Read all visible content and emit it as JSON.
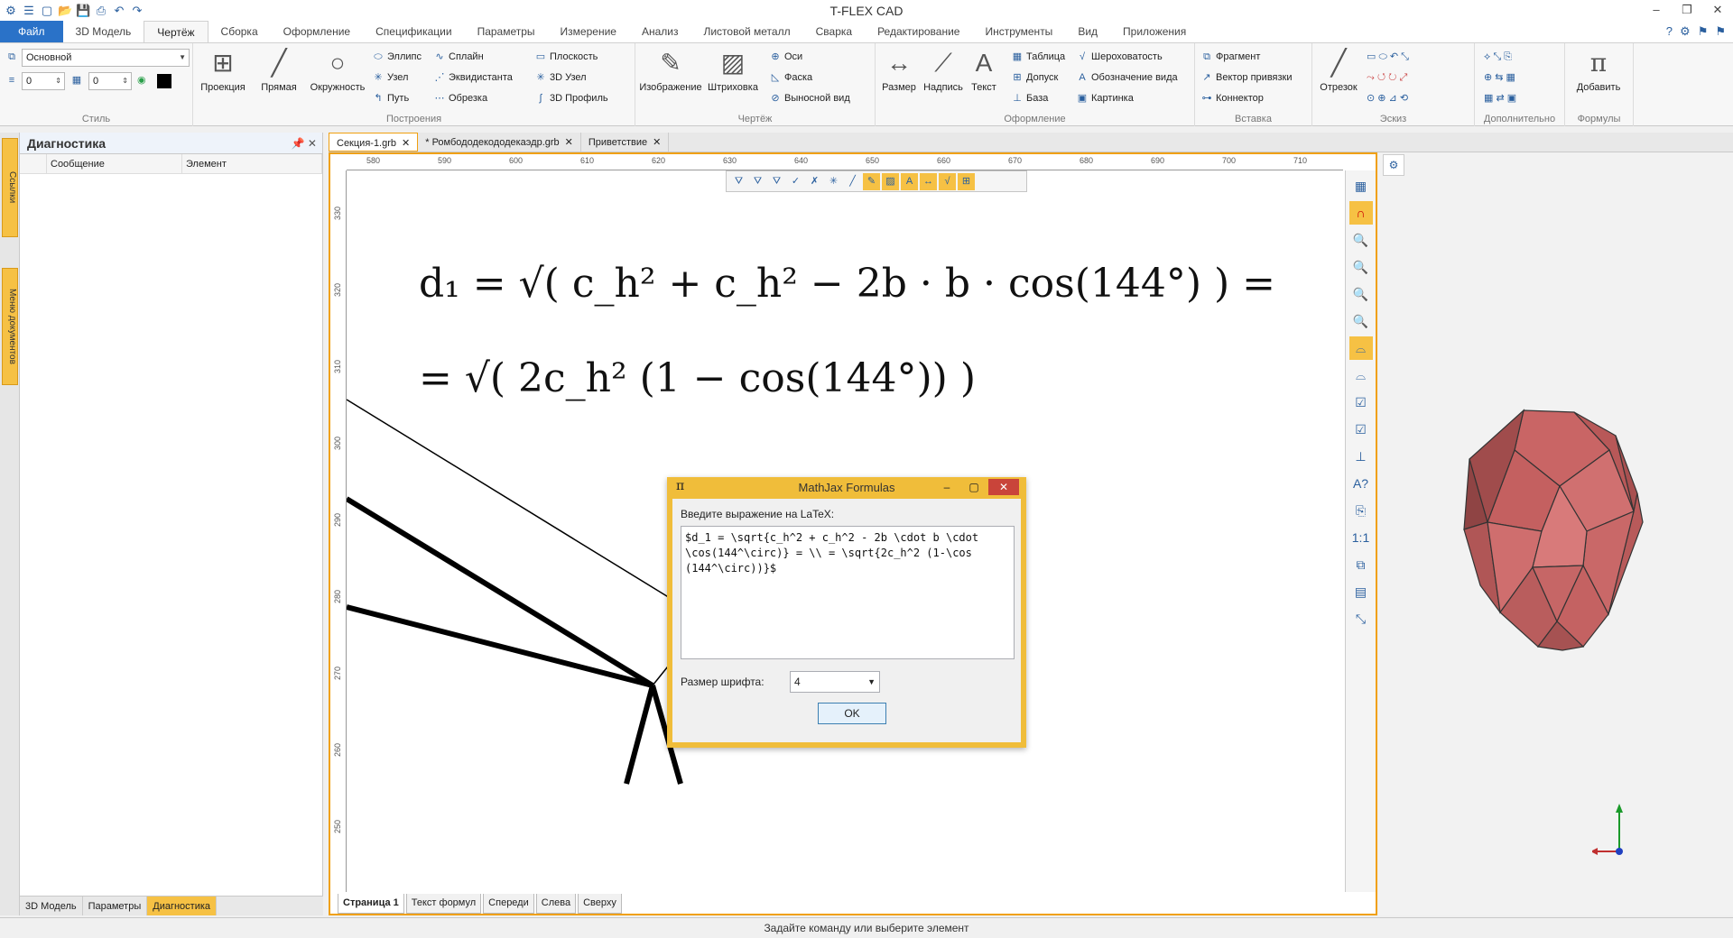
{
  "app": {
    "title": "T-FLEX CAD"
  },
  "ribbon_tabs": [
    "Файл",
    "3D Модель",
    "Чертёж",
    "Сборка",
    "Оформление",
    "Спецификации",
    "Параметры",
    "Измерение",
    "Анализ",
    "Листовой металл",
    "Сварка",
    "Редактирование",
    "Инструменты",
    "Вид",
    "Приложения"
  ],
  "ribbon": {
    "style": {
      "label": "Стиль",
      "layer": "Основной",
      "val1": "0",
      "val2": "0"
    },
    "constructions": {
      "label": "Построения",
      "projection": "Проекция",
      "line": "Прямая",
      "circle": "Окружность",
      "ellipse": "Эллипс",
      "spline": "Сплайн",
      "plane": "Плоскость",
      "node": "Узел",
      "equidistant": "Эквидистанта",
      "node3d": "3D Узел",
      "path": "Путь",
      "trim": "Обрезка",
      "profile3d": "3D Профиль"
    },
    "drawing": {
      "label": "Чертёж",
      "image": "Изображение",
      "hatch": "Штриховка",
      "axes": "Оси",
      "chamfer": "Фаска",
      "callout": "Выносной вид"
    },
    "design": {
      "label": "Оформление",
      "size": "Размер",
      "inscription": "Надпись",
      "text": "Текст",
      "table": "Таблица",
      "tolerance": "Допуск",
      "base": "База",
      "roughness": "Шероховатость",
      "view_mark": "Обозначение вида",
      "picture": "Картинка"
    },
    "insert": {
      "label": "Вставка",
      "fragment": "Фрагмент",
      "snap_vector": "Вектор привязки",
      "connector": "Коннектор"
    },
    "sketch": {
      "label": "Эскиз",
      "segment": "Отрезок"
    },
    "extra": {
      "label": "Дополнительно"
    },
    "formulas": {
      "label": "Формулы",
      "add": "Добавить"
    }
  },
  "left_panel": {
    "title": "Диагностика",
    "columns": [
      "Сообщение",
      "Элемент"
    ],
    "side_tabs": [
      "Ссылки",
      "Меню документов"
    ],
    "bottom_tabs": [
      "3D Модель",
      "Параметры",
      "Диагностика"
    ]
  },
  "doc_tabs": [
    "Секция-1.grb",
    "* Ромбододекододекаэдр.grb",
    "Приветствие"
  ],
  "ruler": {
    "top": [
      "580",
      "590",
      "600",
      "610",
      "620",
      "630",
      "640",
      "650",
      "660",
      "670",
      "680",
      "690",
      "700",
      "710"
    ],
    "left": [
      "330",
      "320",
      "310",
      "300",
      "290",
      "280",
      "270",
      "260",
      "250"
    ]
  },
  "formulas": {
    "line1": "d₁ = √( c_h² + c_h² − 2b · b · cos(144°) ) =",
    "line2": "= √( 2c_h² (1 − cos(144°)) )"
  },
  "sheet_tabs": [
    "Страница 1",
    "Текст формул",
    "Спереди",
    "Слева",
    "Сверху"
  ],
  "dialog": {
    "title": "MathJax Formulas",
    "prompt": "Введите выражение на LaTeX:",
    "latex": "$d_1 = \\sqrt{c_h^2 + c_h^2 - 2b \\cdot b \\cdot\n\\cos(144^\\circ)} = \\\\ = \\sqrt{2c_h^2 (1-\\cos\n(144^\\circ))}$",
    "font_label": "Размер шрифта:",
    "font_size": "4",
    "ok": "OK"
  },
  "status": "Задайте команду или выберите элемент",
  "colors": {
    "accent": "#f0bd3a",
    "file_tab": "#2a72c8",
    "polyhedron": "#c96464"
  }
}
